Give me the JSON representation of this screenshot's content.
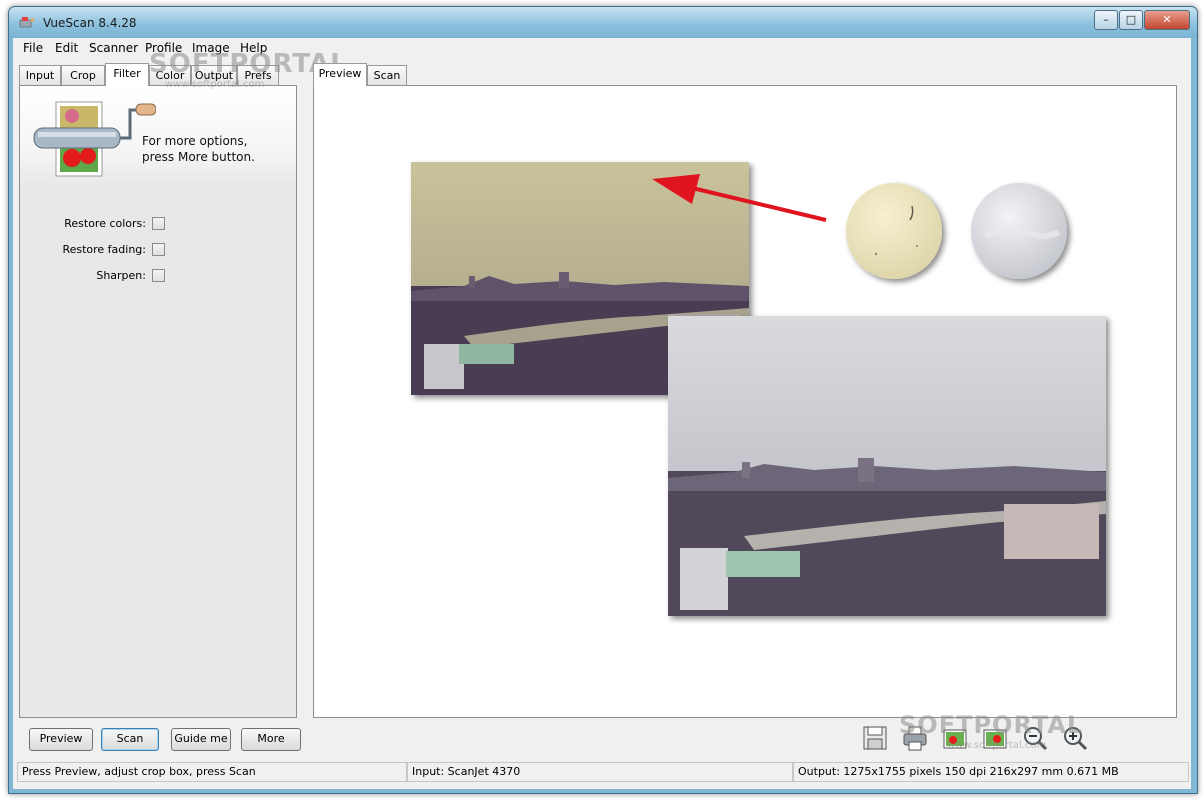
{
  "window": {
    "title": "VueScan 8.4.28"
  },
  "menu": [
    "File",
    "Edit",
    "Scanner",
    "Profile",
    "Image",
    "Help"
  ],
  "left_tabs": [
    "Input",
    "Crop",
    "Filter",
    "Color",
    "Output",
    "Prefs"
  ],
  "active_left_tab": "Filter",
  "panel": {
    "hint_line1": "For more options,",
    "hint_line2": "press More button.",
    "options": [
      {
        "label": "Restore colors:",
        "checked": false
      },
      {
        "label": "Restore fading:",
        "checked": false
      },
      {
        "label": "Sharpen:",
        "checked": false
      }
    ]
  },
  "right_tabs": [
    "Preview",
    "Scan"
  ],
  "active_right_tab": "Preview",
  "buttons": {
    "preview": "Preview",
    "scan": "Scan",
    "guide": "Guide me",
    "more": "More"
  },
  "toolbar_icons": [
    "save-icon",
    "print-icon",
    "image-icon",
    "image-alt-icon",
    "zoom-out-icon",
    "zoom-in-icon"
  ],
  "status": {
    "left": "Press Preview, adjust crop box, press Scan",
    "middle": "Input: ScanJet 4370",
    "right": "Output: 1275x1755 pixels 150 dpi 216x297 mm 0.671 MB"
  },
  "watermark": {
    "brand": "SOFTPORTAL",
    "url": "www.softportal.com"
  },
  "colors": {
    "title_bar": "#8dc2de",
    "arrow": "#e0141e",
    "close_button": "#c2452f"
  }
}
